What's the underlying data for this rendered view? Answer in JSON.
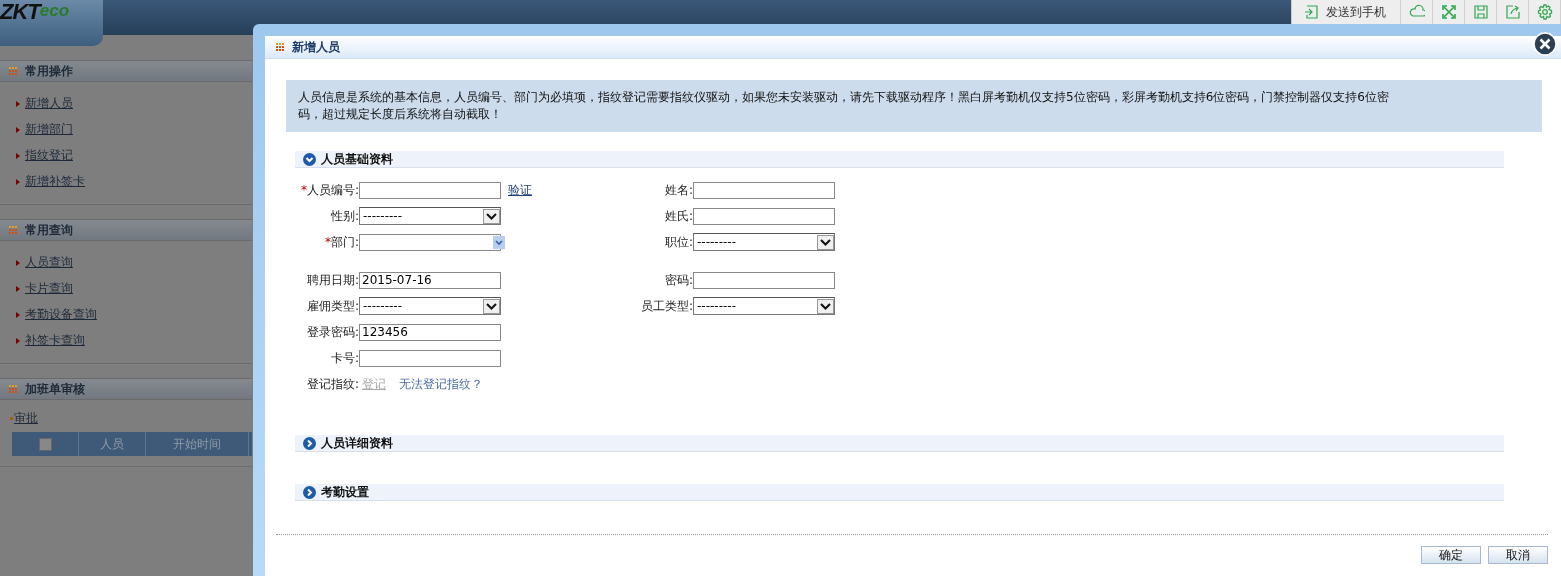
{
  "background_page": {
    "logo": {
      "main": "ZKT",
      "sub": "eco"
    },
    "sidebar": {
      "sections": [
        {
          "title": "常用操作",
          "items": [
            "新增人员",
            "新增部门",
            "指纹登记",
            "新增补签卡"
          ]
        },
        {
          "title": "常用查询",
          "items": [
            "人员查询",
            "卡片查询",
            "考勤设备查询",
            "补签卡查询"
          ]
        },
        {
          "title": "加班单审核",
          "link": "审批",
          "table": {
            "columns": [
              {
                "kind": "checkbox",
                "checked": false
              },
              {
                "kind": "text",
                "label": "人员"
              },
              {
                "kind": "text",
                "label": "开始时间"
              }
            ]
          }
        }
      ]
    }
  },
  "toolbar": {
    "send_button": "发送到手机"
  },
  "dialog": {
    "title": "新增人员",
    "notice": "人员信息是系统的基本信息，人员编号、部门为必填项，指纹登记需要指纹仪驱动，如果您未安装驱动，请先下载驱动程序！黑白屏考勤机仅支持5位密码，彩屏考勤机支持6位密码，门禁控制器仅支持6位密码，超过规定长度后系统将自动截取！",
    "sections": [
      {
        "title": "人员基础资料",
        "expanded": true,
        "groups": [
          [
            {
              "left": {
                "kind": "text",
                "required_mark": "*",
                "label": "人员编号:",
                "link": "验证"
              },
              "right": {
                "kind": "text",
                "label": "姓名:"
              }
            },
            {
              "left": {
                "kind": "select",
                "label": "性别:",
                "value": "---------"
              },
              "right": {
                "kind": "text",
                "label": "姓氏:"
              }
            },
            {
              "left": {
                "kind": "tree",
                "required_mark": "*",
                "label": "部门:"
              },
              "right": {
                "kind": "select",
                "label": "职位:",
                "value": "---------"
              }
            }
          ],
          [
            {
              "left": {
                "kind": "text",
                "label": "聘用日期:",
                "value": "2015-07-16"
              },
              "right": {
                "kind": "text",
                "label": "密码:"
              }
            },
            {
              "left": {
                "kind": "select",
                "label": "雇佣类型:",
                "value": "---------"
              },
              "right": {
                "kind": "select",
                "label": "员工类型:",
                "value": "---------"
              }
            },
            {
              "left": {
                "kind": "text",
                "label": "登录密码:",
                "value": "123456"
              }
            },
            {
              "left": {
                "kind": "text",
                "label": "卡号:"
              }
            },
            {
              "left": {
                "kind": "links",
                "label": "登记指纹:",
                "links": [
                  {
                    "text": "登记",
                    "disabled": true
                  },
                  {
                    "text": "无法登记指纹？",
                    "disabled": false
                  }
                ]
              }
            }
          ]
        ]
      },
      {
        "title": "人员详细资料",
        "expanded": false
      },
      {
        "title": "考勤设置",
        "expanded": false
      }
    ],
    "buttons": [
      "确定",
      "取消"
    ]
  }
}
